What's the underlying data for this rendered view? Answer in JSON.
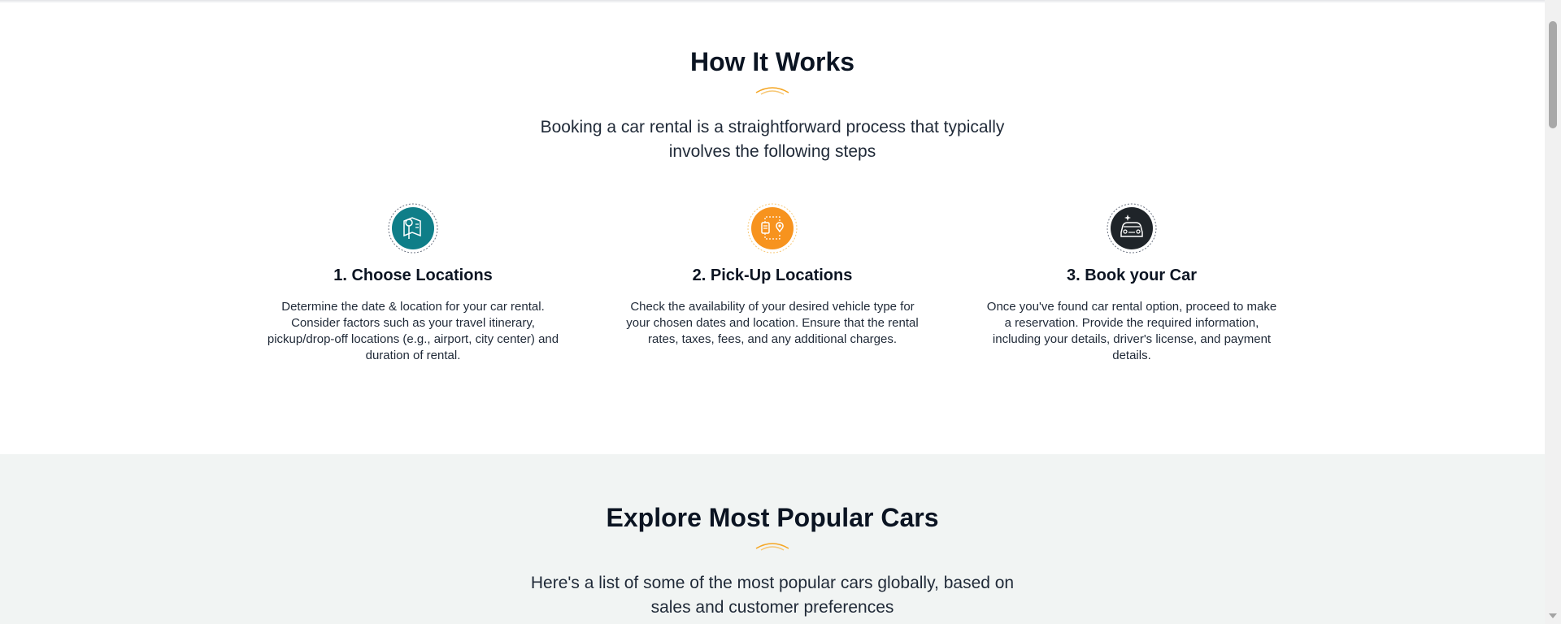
{
  "how_it_works": {
    "title": "How It Works",
    "subtitle": "Booking a car rental is a straightforward process that typically involves the following steps",
    "steps": [
      {
        "title": "1. Choose Locations",
        "text": "Determine the date & location for your car rental. Consider factors such as your travel itinerary, pickup/drop-off locations (e.g., airport, city center) and duration of rental.",
        "icon": "location-map-icon",
        "color": "#0f7e88"
      },
      {
        "title": "2. Pick-Up Locations",
        "text": "Check the availability of your desired vehicle type for your chosen dates and location. Ensure that the rental rates, taxes, fees, and any additional charges.",
        "icon": "route-pin-icon",
        "color": "#f7931e"
      },
      {
        "title": "3. Book your Car",
        "text": "Once you've found car rental option, proceed to make a reservation. Provide the required information, including your details, driver's license, and payment details.",
        "icon": "car-front-icon",
        "color": "#1f2429"
      }
    ]
  },
  "popular_cars": {
    "title": "Explore Most Popular Cars",
    "subtitle": "Here's a list of some of the most popular cars globally, based on sales and customer preferences"
  },
  "colors": {
    "accent": "#f5a623",
    "heading": "#0b1422",
    "section_alt_bg": "#f1f4f3"
  }
}
